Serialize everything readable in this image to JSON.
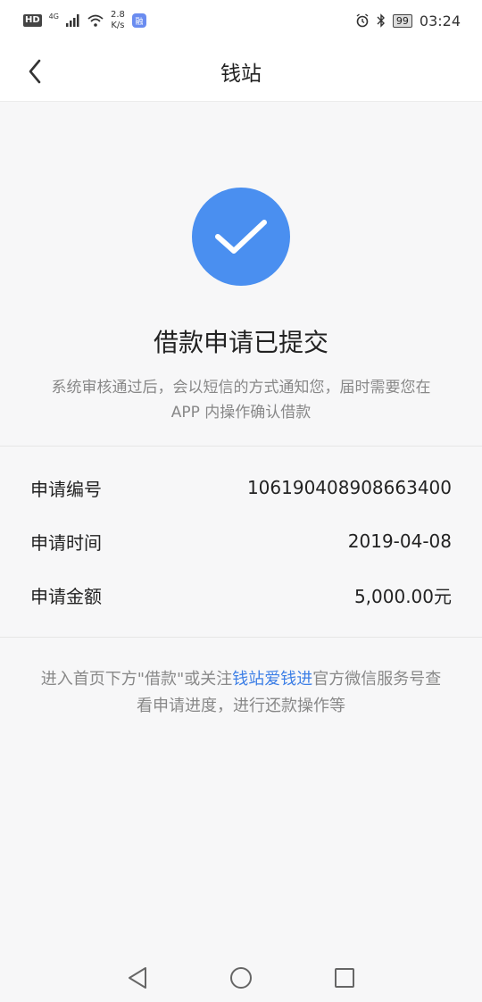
{
  "status_bar": {
    "hd": "HD",
    "network": "4G",
    "speed_value": "2.8",
    "speed_unit": "K/s",
    "app_badge": "融",
    "battery": "99",
    "time": "03:24"
  },
  "nav": {
    "title": "钱站"
  },
  "success": {
    "title": "借款申请已提交",
    "description": "系统审核通过后，会以短信的方式通知您，届时需要您在 APP 内操作确认借款"
  },
  "info": {
    "rows": [
      {
        "label": "申请编号",
        "value": "106190408908663400"
      },
      {
        "label": "申请时间",
        "value": "2019-04-08"
      },
      {
        "label": "申请金额",
        "value": "5,000.00元"
      }
    ]
  },
  "note": {
    "prefix": "进入首页下方\"借款\"或关注",
    "link": "钱站爱钱进",
    "suffix": "官方微信服务号查看申请进度，进行还款操作等"
  },
  "colors": {
    "accent": "#4a8ff0",
    "link": "#3d7fe6",
    "muted_text": "#888888"
  }
}
